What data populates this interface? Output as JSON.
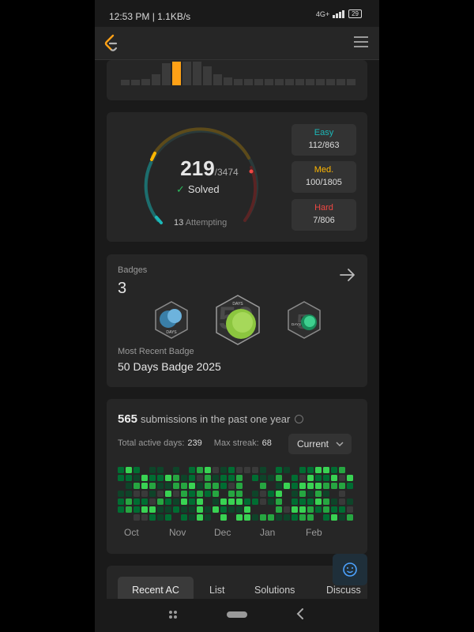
{
  "status_bar": {
    "time": "12:53 PM | 1.1KB/s",
    "network": "4G+",
    "battery": "29"
  },
  "app": {
    "logo_icon": "leetcode-logo-icon",
    "menu_icon": "hamburger-menu-icon"
  },
  "progress": {
    "solved": "219",
    "total": "/3474",
    "solved_label": "Solved",
    "attempting_count": "13",
    "attempting_label": "Attempting",
    "difficulties": [
      {
        "label": "Easy",
        "value": "112/863",
        "color": "#1cb8b8"
      },
      {
        "label": "Med.",
        "value": "100/1805",
        "color": "#ffb700"
      },
      {
        "label": "Hard",
        "value": "7/806",
        "color": "#ef4743"
      }
    ]
  },
  "badges": {
    "title": "Badges",
    "count": "3",
    "recent_label": "Most Recent Badge",
    "recent_name": "50 Days Badge 2025",
    "arrow_icon": "arrow-right-icon"
  },
  "submissions": {
    "count": "565",
    "text": "submissions in the past one year",
    "active_days_label": "Total active days:",
    "active_days": "239",
    "max_streak_label": "Max streak:",
    "max_streak": "68",
    "period": "Current",
    "months": [
      "Oct",
      "Nov",
      "Dec",
      "Jan",
      "Feb"
    ]
  },
  "tabs": [
    "Recent AC",
    "List",
    "Solutions",
    "Discuss"
  ]
}
